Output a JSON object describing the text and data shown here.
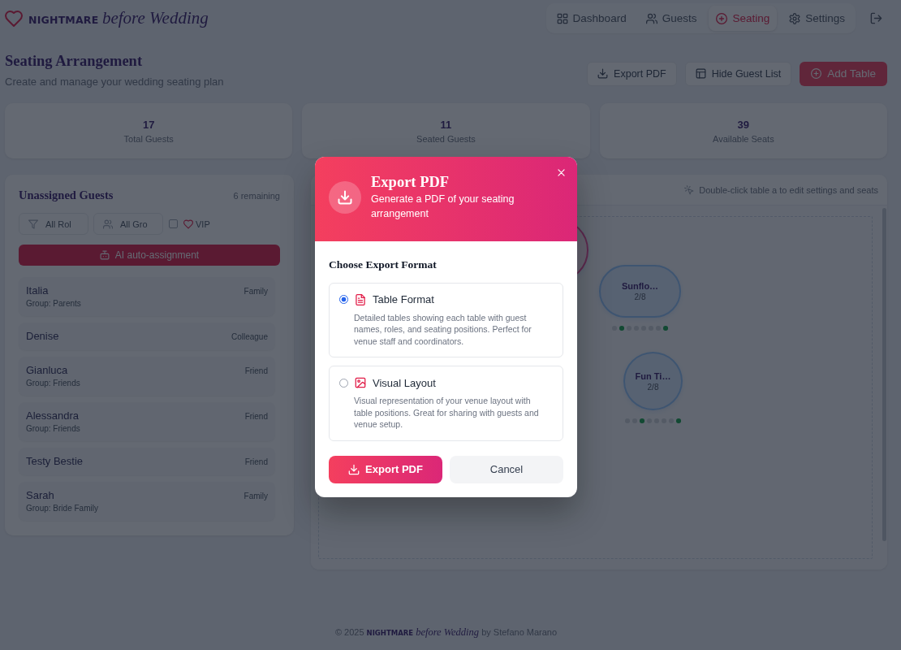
{
  "header": {
    "logo_mark": "NIGHTMARE",
    "logo_script": "before Wedding",
    "nav": [
      {
        "label": "Dashboard",
        "selected": false
      },
      {
        "label": "Guests",
        "selected": false
      },
      {
        "label": "Seating",
        "selected": true
      },
      {
        "label": "Settings",
        "selected": false
      }
    ]
  },
  "page": {
    "title": "Seating Arrangement",
    "subtitle": "Create and manage your wedding seating plan",
    "actions": [
      {
        "label": "Export PDF",
        "kind": "secondary"
      },
      {
        "label": "Hide Guest List",
        "kind": "secondary"
      },
      {
        "label": "Add Table",
        "kind": "primary"
      }
    ]
  },
  "stats": [
    {
      "value": "17",
      "label": "Total Guests"
    },
    {
      "value": "11",
      "label": "Seated Guests"
    },
    {
      "value": "39",
      "label": "Available Seats"
    }
  ],
  "guest_panel": {
    "title": "Unassigned Guests",
    "remaining": "6 remaining",
    "filters": [
      {
        "value": "All Rol"
      },
      {
        "value": "All Gro"
      }
    ],
    "vip_filter": {
      "label": "VIP",
      "checked": false
    },
    "auto_assign_button": "AI auto-assignment",
    "guests": [
      {
        "name": "Italia",
        "role": "Family",
        "group": "Group: Parents"
      },
      {
        "name": "Denise",
        "role": "Colleague"
      },
      {
        "name": "Gianluca",
        "role": "Friend",
        "group": "Group: Friends"
      },
      {
        "name": "Alessandra",
        "role": "Friend",
        "group": "Group: Friends"
      },
      {
        "name": "Testy Bestie",
        "role": "Friend"
      },
      {
        "name": "Sarah",
        "role": "Family",
        "group": "Group: Bride Family"
      }
    ]
  },
  "canvas": {
    "hint": "Double-click table a to edit settings and seats",
    "tables": [
      {
        "kind": "round",
        "selected": true
      },
      {
        "kind": "oval",
        "selected": false,
        "name": "Sunflo…",
        "count": "2/8",
        "seats": [
          {
            "occupied": false
          },
          {
            "occupied": true
          },
          {
            "occupied": false
          },
          {
            "occupied": false
          },
          {
            "occupied": false
          },
          {
            "occupied": false
          },
          {
            "occupied": false
          },
          {
            "occupied": true
          }
        ]
      },
      {
        "kind": "round",
        "selected": false,
        "name": "Fun Ti…",
        "count": "2/8",
        "seats": [
          {
            "occupied": false
          },
          {
            "occupied": false
          },
          {
            "occupied": true
          },
          {
            "occupied": false
          },
          {
            "occupied": false
          },
          {
            "occupied": false
          },
          {
            "occupied": false
          },
          {
            "occupied": true
          }
        ]
      }
    ]
  },
  "export_dialog": {
    "title": "Export PDF",
    "subtitle": "Generate a PDF of your seating arrangement",
    "section_title": "Choose Export Format",
    "options": [
      {
        "title": "Table Format",
        "description": "Detailed tables showing each table with guest names, roles, and seating positions. Perfect for venue staff and coordinators.",
        "selected": true
      },
      {
        "title": "Visual Layout",
        "description": "Visual representation of your venue layout with table positions. Great for sharing with guests and venue setup.",
        "selected": false
      }
    ],
    "buttons": [
      {
        "label": "Export PDF",
        "kind": "primary"
      },
      {
        "label": "Cancel",
        "kind": "secondary"
      }
    ]
  },
  "footer": {
    "text": "© 2025 **NIGHTMARE** *before Wedding* by Stefano Marano"
  }
}
